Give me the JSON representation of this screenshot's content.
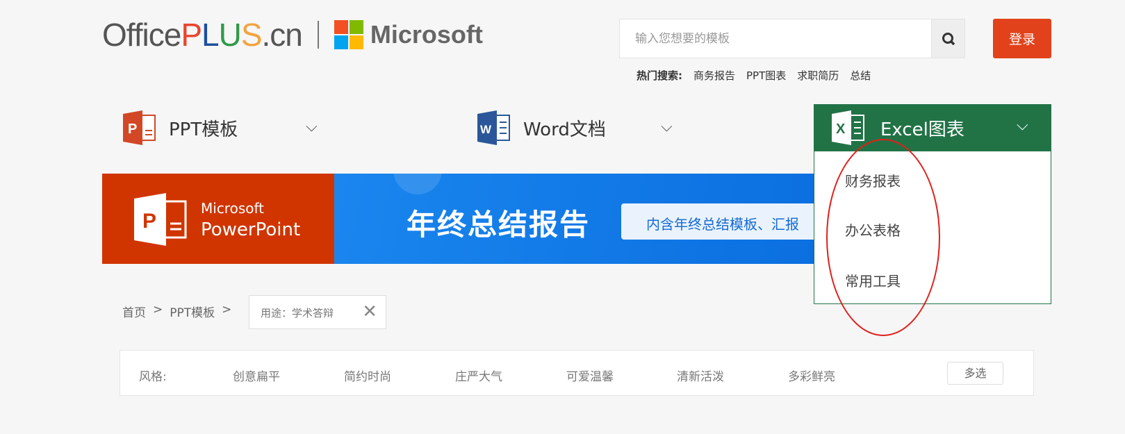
{
  "header": {
    "logo_parts": [
      "Office",
      "P",
      "L",
      "U",
      "S",
      ".cn"
    ],
    "microsoft": "Microsoft",
    "search_placeholder": "输入您想要的模板",
    "login": "登录",
    "hot_label": "热门搜索:",
    "hot": [
      "商务报告",
      "PPT图表",
      "求职简历",
      "总结"
    ]
  },
  "nav": [
    {
      "label": "PPT模板",
      "icon": "P"
    },
    {
      "label": "Word文档",
      "icon": "W"
    },
    {
      "label": "Excel图表",
      "icon": "X"
    }
  ],
  "excel_menu": [
    "财务报表",
    "办公表格",
    "常用工具"
  ],
  "banner": {
    "brand1": "Microsoft",
    "brand2": "PowerPoint",
    "title": "年终总结报告",
    "pill": "内含年终总结模板、汇报"
  },
  "breadcrumb": {
    "home": "首页",
    "sep": ">",
    "ppt": "PPT模板",
    "tag": "用途：学术答辩"
  },
  "filter": {
    "label": "风格:",
    "options": [
      "创意扁平",
      "简约时尚",
      "庄严大气",
      "可爱温馨",
      "清新活泼",
      "多彩鲜亮"
    ],
    "multi": "多选"
  },
  "colors": {
    "excel": "#217346",
    "login": "#e2421b",
    "ppt": "#d03500"
  }
}
